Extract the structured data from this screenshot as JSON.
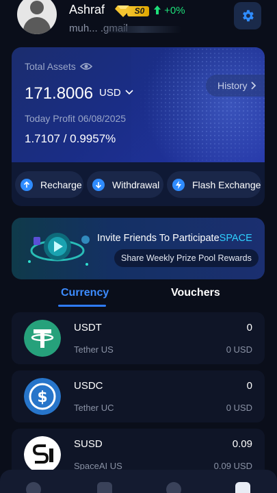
{
  "header": {
    "username": "Ashraf",
    "vip_level": "S0",
    "change": "+0%",
    "email": "muh... .gmail"
  },
  "assets": {
    "label": "Total Assets",
    "amount": "171.8006",
    "currency": "USD",
    "history_label": "History",
    "today_profit_label": "Today Profit",
    "profit_date": "06/08/2025",
    "profit_value": "1.7107 / 0.9957%"
  },
  "actions": {
    "recharge": "Recharge",
    "withdrawal": "Withdrawal",
    "flash": "Flash Exchange"
  },
  "banner": {
    "title": "Invite Friends To Participate",
    "title_accent": "SPACE",
    "subtitle": "Share Weekly Prize Pool Rewards"
  },
  "tabs": {
    "currency": "Currency",
    "vouchers": "Vouchers"
  },
  "coins": [
    {
      "symbol": "USDT",
      "name": "Tether US",
      "amount": "0",
      "usd": "0 USD"
    },
    {
      "symbol": "USDC",
      "name": "Tether UC",
      "amount": "0",
      "usd": "0 USD"
    },
    {
      "symbol": "SUSD",
      "name": "SpaceAI US",
      "amount": "0.09",
      "usd": "0.09 USD"
    }
  ],
  "colors": {
    "accent": "#2f7cff",
    "positive": "#1ee07a",
    "usdt": "#26a17b",
    "usdc": "#2775ca"
  }
}
